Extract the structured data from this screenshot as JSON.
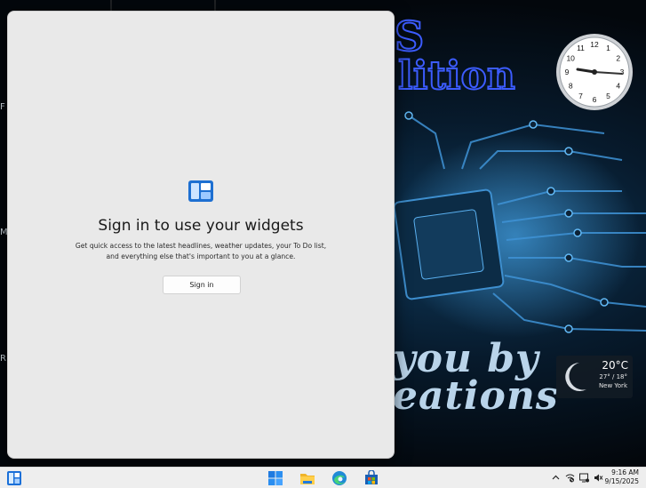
{
  "wallpaper": {
    "title_fragment": "S",
    "subtitle_fragment": "lition",
    "script_line1": "you by",
    "script_line2": "eations",
    "left_edge_letters": [
      "F",
      "M",
      "R"
    ]
  },
  "widgets_panel": {
    "icon": "widgets-icon",
    "title": "Sign in to use your widgets",
    "description": "Get quick access to the latest headlines, weather updates, your To Do list, and everything else that's important to you at a glance.",
    "signin_label": "Sign in"
  },
  "clock": {
    "numbers": [
      "12",
      "1",
      "2",
      "3",
      "4",
      "5",
      "6",
      "7",
      "8",
      "9",
      "10",
      "11"
    ],
    "time": "9:16"
  },
  "weather": {
    "temperature": "20°C",
    "range": "27° / 18°",
    "city": "New York",
    "icon": "crescent-moon-icon"
  },
  "taskbar": {
    "widgets_icon": "widgets-icon",
    "apps": [
      "start-icon",
      "file-explorer-icon",
      "edge-icon",
      "store-icon"
    ],
    "tray": [
      "chevron-up-icon",
      "network-off-icon",
      "display-icon",
      "volume-mute-icon"
    ],
    "time": "9:16 AM",
    "date": "9/15/2025"
  }
}
